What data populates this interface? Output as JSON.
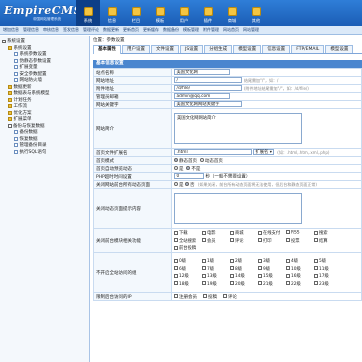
{
  "header": {
    "logo": "EmpireCMS",
    "logo_sub": "帝国网站管理系统",
    "nav": [
      {
        "label": "系统",
        "icon": "system-icon",
        "active": true
      },
      {
        "label": "信息",
        "icon": "info-icon"
      },
      {
        "label": "栏目",
        "icon": "column-icon"
      },
      {
        "label": "模板",
        "icon": "template-icon"
      },
      {
        "label": "用户",
        "icon": "user-icon"
      },
      {
        "label": "插件",
        "icon": "plugin-icon"
      },
      {
        "label": "商城",
        "icon": "shop-icon"
      },
      {
        "label": "其他",
        "icon": "other-icon"
      }
    ]
  },
  "subnav": [
    "增加信息",
    "管理信息",
    "审核信息",
    "签发信息",
    "管理评论",
    "数据更新",
    "更新首页",
    "更新缓存",
    "数据备份",
    "模板管理",
    "附件管理",
    "网站首页",
    "网站管理"
  ],
  "sidebar": [
    {
      "label": "系统设置",
      "type": "minus",
      "indent": 0
    },
    {
      "label": "系统设置",
      "type": "folder",
      "indent": 1
    },
    {
      "label": "系统参数设置",
      "type": "page",
      "indent": 2
    },
    {
      "label": "伪静态参数设置",
      "type": "page",
      "indent": 2
    },
    {
      "label": "扩展变量",
      "type": "page",
      "indent": 2
    },
    {
      "label": "安全参数配置",
      "type": "page",
      "indent": 2
    },
    {
      "label": "网站防火墙",
      "type": "page",
      "indent": 2
    },
    {
      "label": "数据更新",
      "type": "folder",
      "indent": 1
    },
    {
      "label": "数据表与系统模型",
      "type": "folder",
      "indent": 1
    },
    {
      "label": "计划任务",
      "type": "folder",
      "indent": 1
    },
    {
      "label": "工作流",
      "type": "folder",
      "indent": 1
    },
    {
      "label": "优化方案",
      "type": "folder",
      "indent": 1
    },
    {
      "label": "扩展菜单",
      "type": "folder",
      "indent": 1
    },
    {
      "label": "备份与恢复数据",
      "type": "minus",
      "indent": 1
    },
    {
      "label": "备份数据",
      "type": "page",
      "indent": 2
    },
    {
      "label": "恢复数据",
      "type": "page",
      "indent": 2
    },
    {
      "label": "管理备份目录",
      "type": "page",
      "indent": 2
    },
    {
      "label": "执行SQL语句",
      "type": "page",
      "indent": 2
    }
  ],
  "main": {
    "crumb": "位置：参数设置",
    "tabs": [
      "基本属性",
      "用户设置",
      "文件设置",
      "JS设置",
      "分组生成",
      "模型设置",
      "信息设置",
      "FTP/EMAIL",
      "模型设置"
    ],
    "section_title": "基本信息设置",
    "site_name_label": "站点名称",
    "site_name_value": "美国文化网",
    "site_url_label": "网站地址",
    "site_url_value": "/",
    "site_url_hint": "结尾需加\"/\"，如：/",
    "attach_url_label": "附件地址",
    "attach_url_value": "/d/file/",
    "attach_url_hint": "(附件地址结尾需加\"/\"，如：/d/file/)",
    "email_label": "管理员邮箱",
    "email_value": "admin@qq.com",
    "keywords_label": "网站关键字",
    "keywords_value": "美国文化网网站关键字",
    "desc_label": "网站简介",
    "desc_value": "美国文化网网站简介",
    "index_ext_label": "首页文件扩展名",
    "index_ext_value": ".html",
    "index_ext_select": "扩展名",
    "index_ext_hint": "(如：.html,.htm,.xml,.php)",
    "index_mode_label": "首页模式",
    "index_mode_opts": [
      "静态首页",
      "动态首页"
    ],
    "index_mode_selected": 0,
    "close_site_label": "首页自动预览动态",
    "close_site_opts": [
      "是",
      "不是"
    ],
    "close_site_selected": 1,
    "php_time_label": "PHP超时时间设置",
    "php_time_value": "0",
    "php_time_unit": "秒（一般不需要设置）",
    "close_site2_label": "关闭网站前台所有动态页面",
    "close_site2_opts": [
      "是",
      "否"
    ],
    "close_site2_selected": 1,
    "close_site2_hint": "(如果关闭，前台所有动态页面将无法使用，但后台和静态页面正常)",
    "close_tip_label": "关闭动态页面提示内容",
    "close_funcs_label": "关闭前台模块相关功能",
    "close_funcs": [
      "下载",
      "电影",
      "商城",
      "在线支付",
      "RSS",
      "搜索",
      "全站搜索",
      "会员",
      "评论",
      "打印",
      "投票",
      "结算",
      "前台投稿"
    ],
    "levels_label": "不开启全站访问的组",
    "levels": [
      "0级",
      "1级",
      "2级",
      "3级",
      "4级",
      "5级",
      "6级",
      "7级",
      "8级",
      "9级",
      "10级",
      "11级",
      "12级",
      "13级",
      "14级",
      "15级",
      "16级",
      "17级",
      "18级",
      "19级",
      "20级",
      "21级",
      "22级",
      "23级"
    ],
    "limit_label": "限制后台访问的IP",
    "limit_opts": [
      "注册会员",
      "投稿",
      "评论"
    ]
  }
}
